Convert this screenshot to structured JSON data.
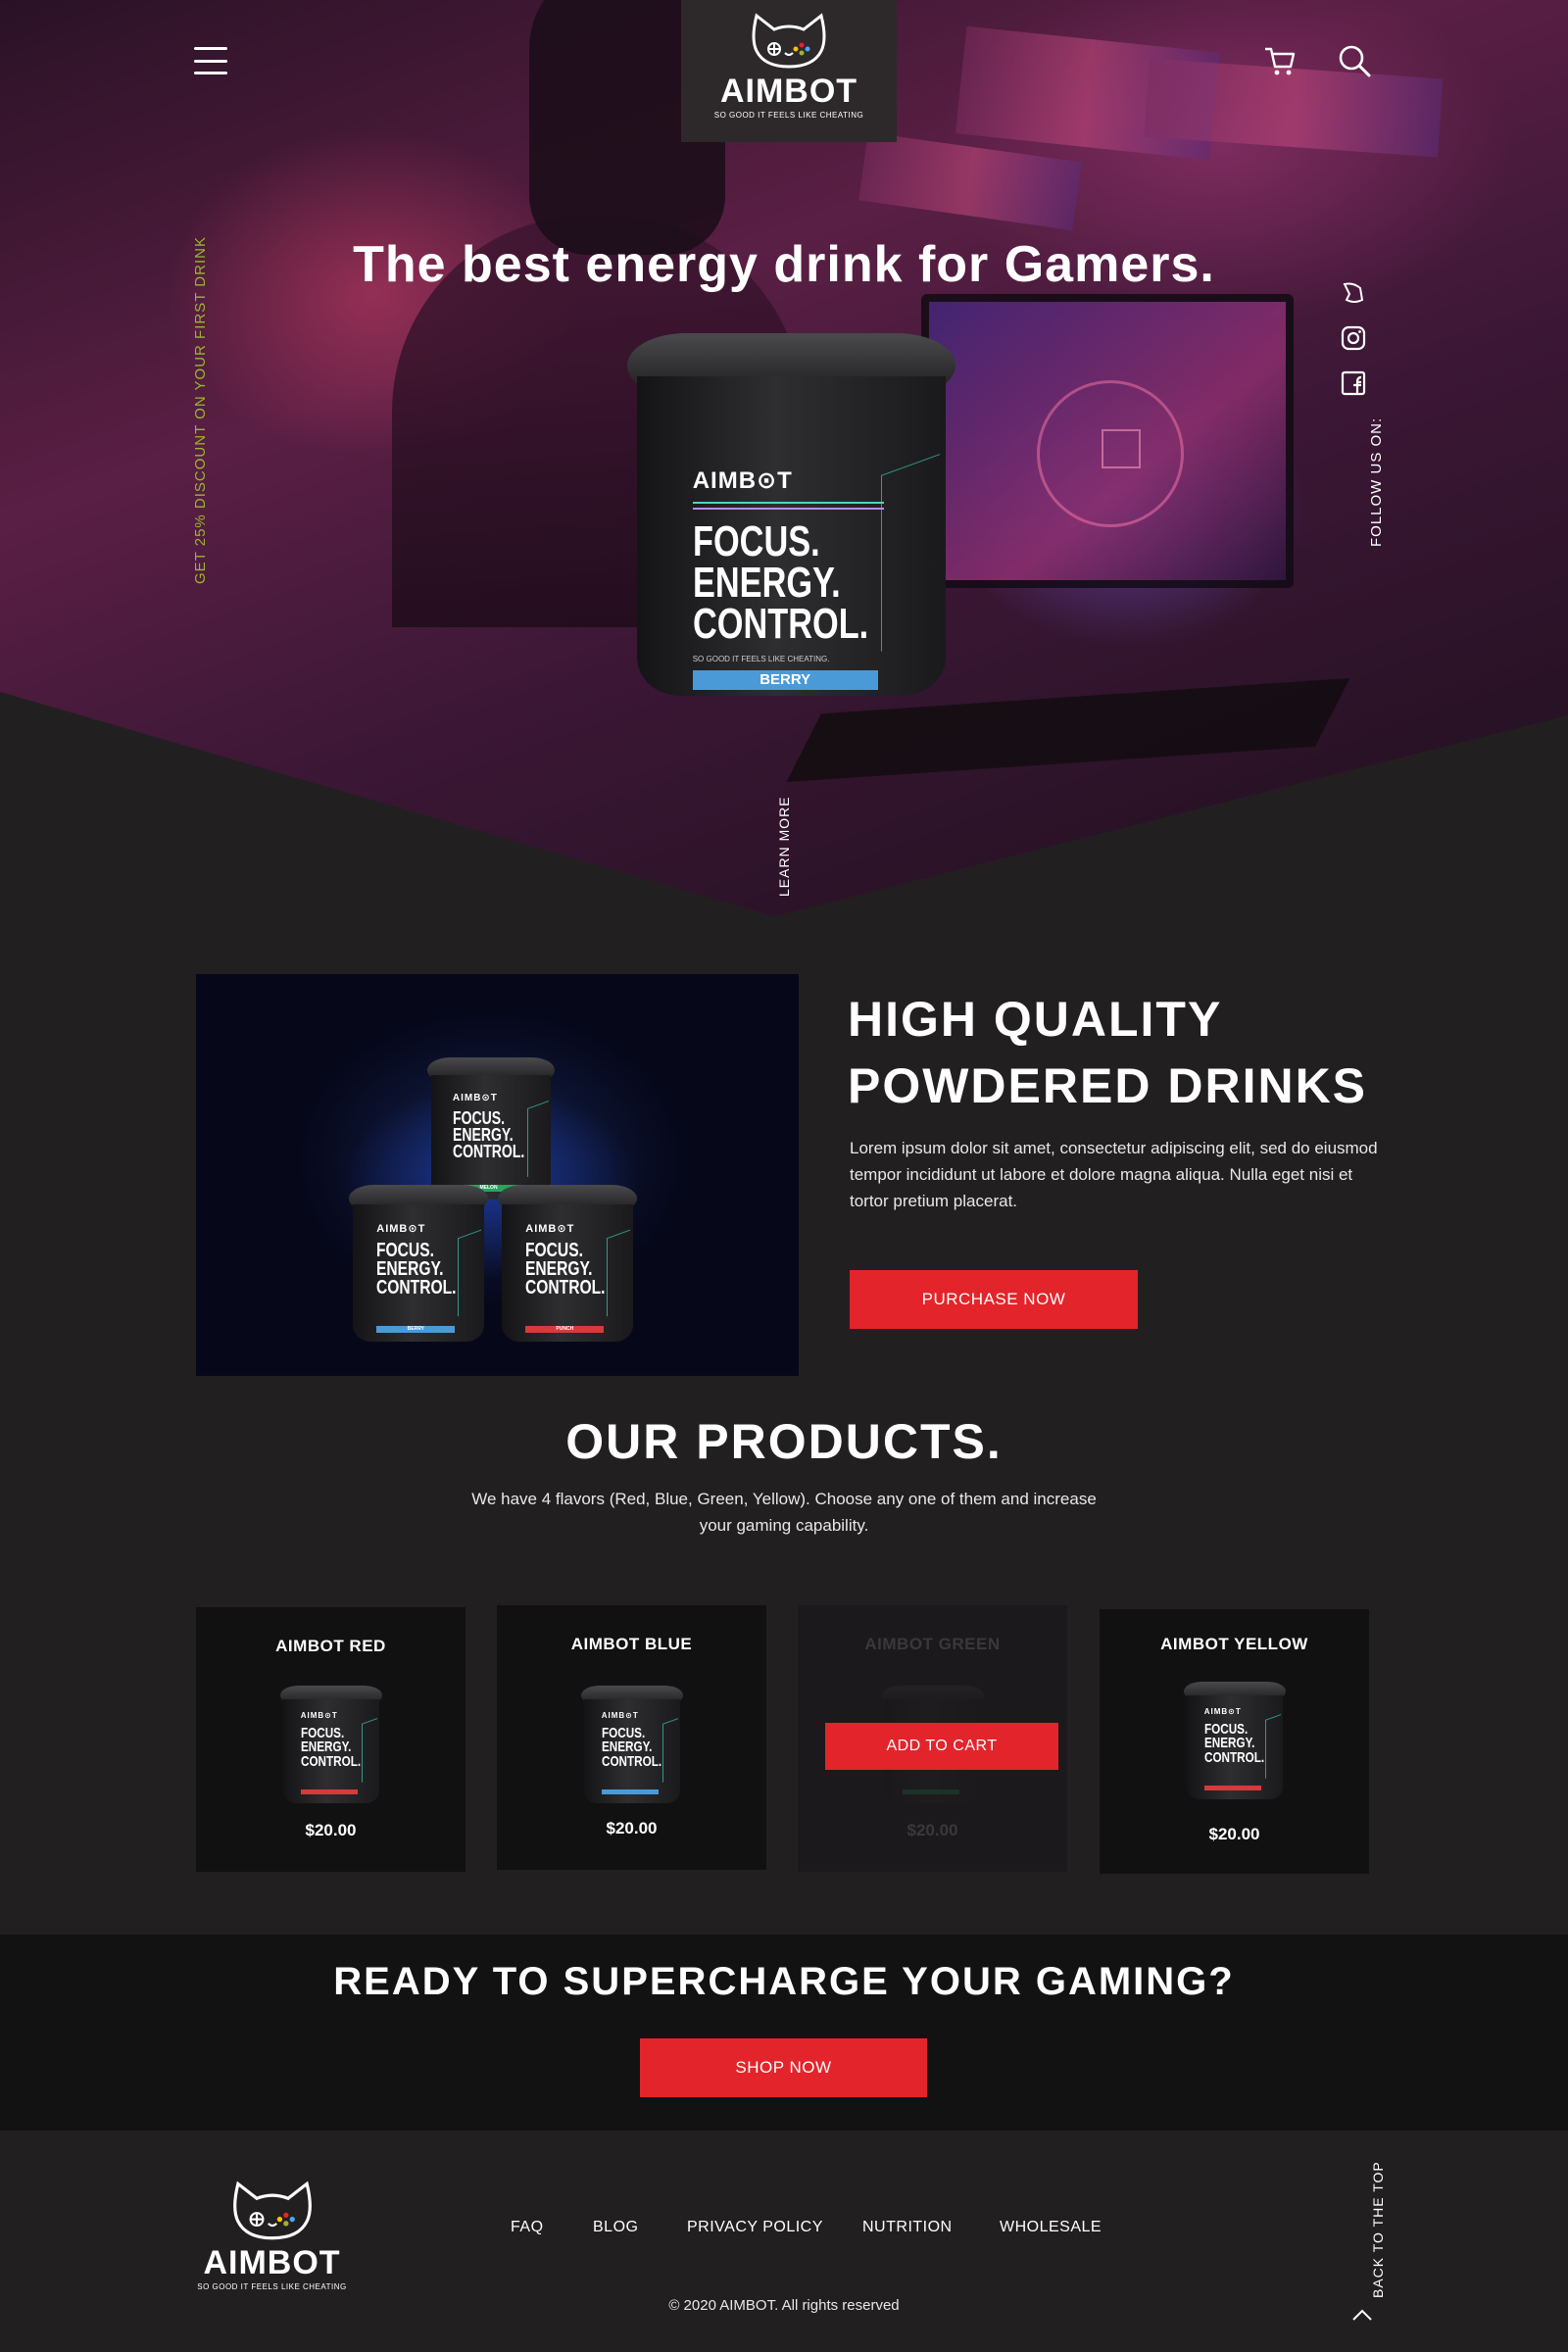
{
  "header": {
    "logo_text": "AIMBOT",
    "logo_tagline": "SO GOOD IT FEELS LIKE CHEATING",
    "menu_icon": "hamburger-menu-icon",
    "cart_icon": "shopping-cart-icon",
    "search_icon": "search-icon"
  },
  "hero": {
    "title": "The best energy drink for Gamers.",
    "promo_vertical": "GET 25% DISCOUNT ON YOUR FIRST DRINK",
    "follow_label": "FOLLOW US ON:",
    "learn_more": "LEARN MORE",
    "social_icons": [
      "discord-icon",
      "instagram-icon",
      "facebook-icon"
    ],
    "jar": {
      "brand": "AIMB⊙T",
      "line1": "FOCUS.",
      "line2": "ENERGY.",
      "line3": "CONTROL.",
      "tagline": "SO GOOD IT FEELS LIKE CHEATING.",
      "flavor": "BERRY"
    }
  },
  "quality": {
    "title_line1": "HIGH QUALITY",
    "title_line2": "POWDERED DRINKS",
    "text": "Lorem ipsum dolor sit amet, consectetur adipiscing elit, sed do eiusmod tempor incididunt ut labore et dolore magna aliqua. Nulla eget nisi et tortor pretium placerat.",
    "button": "PURCHASE NOW",
    "image_jars": [
      {
        "flavor": "MELON"
      },
      {
        "flavor": "BERRY"
      },
      {
        "flavor": "PUNCH"
      }
    ]
  },
  "products": {
    "title": "OUR PRODUCTS.",
    "description": "We have 4 flavors (Red, Blue, Green, Yellow). Choose any one of them and increase your gaming capability.",
    "add_to_cart": "ADD TO CART",
    "items": [
      {
        "name": "AIMBOT RED",
        "price": "$20.00"
      },
      {
        "name": "AIMBOT BLUE",
        "price": "$20.00"
      },
      {
        "name": "AIMBOT GREEN",
        "price": "$20.00"
      },
      {
        "name": "AIMBOT YELLOW",
        "price": "$20.00"
      }
    ]
  },
  "cta": {
    "title": "READY TO SUPERCHARGE YOUR GAMING?",
    "button": "SHOP NOW"
  },
  "footer": {
    "logo_text": "AIMBOT",
    "logo_tagline": "SO GOOD IT FEELS LIKE CHEATING",
    "links": [
      "FAQ",
      "BLOG",
      "PRIVACY POLICY",
      "NUTRITION",
      "WHOLESALE"
    ],
    "copyright": "© 2020 AIMBOT. All rights reserved",
    "back_to_top": "BACK TO THE TOP"
  },
  "colors": {
    "background": "#221f20",
    "accent_red": "#e3242b",
    "promo_green": "#9bb531",
    "card_bg": "#121112",
    "cta_bg": "#131213"
  }
}
